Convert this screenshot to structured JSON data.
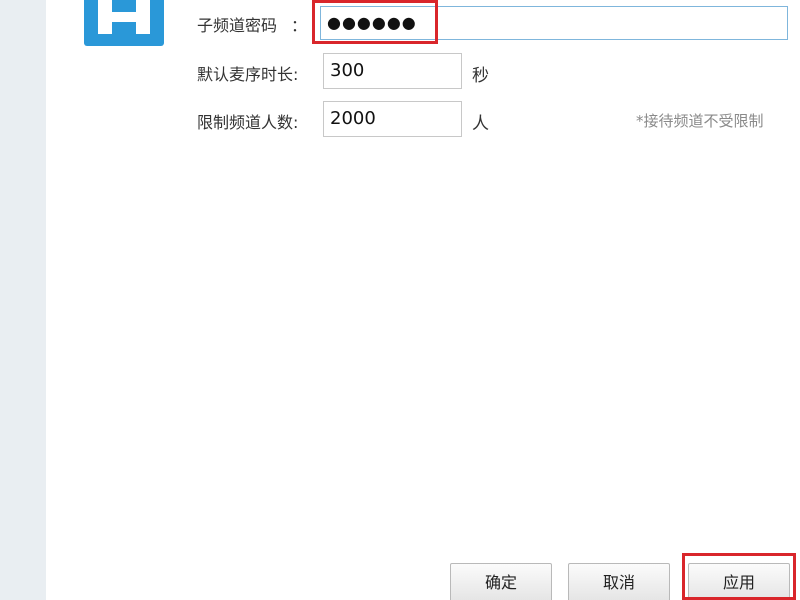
{
  "form": {
    "password_label": "子频道密码",
    "password_colon": "：",
    "password_value": "●●●●●●",
    "duration_label": "默认麦序时长:",
    "duration_value": "300",
    "duration_unit": "秒",
    "limit_label": "限制频道人数:",
    "limit_value": "2000",
    "limit_unit": "人",
    "limit_hint": "*接待频道不受限制"
  },
  "buttons": {
    "confirm": "确定",
    "cancel": "取消",
    "apply": "应用"
  },
  "colors": {
    "accent": "#2a98d8",
    "highlight": "#d9262b",
    "sidebar": "#e9eef2"
  },
  "icons": {
    "channel": "channel-icon"
  }
}
